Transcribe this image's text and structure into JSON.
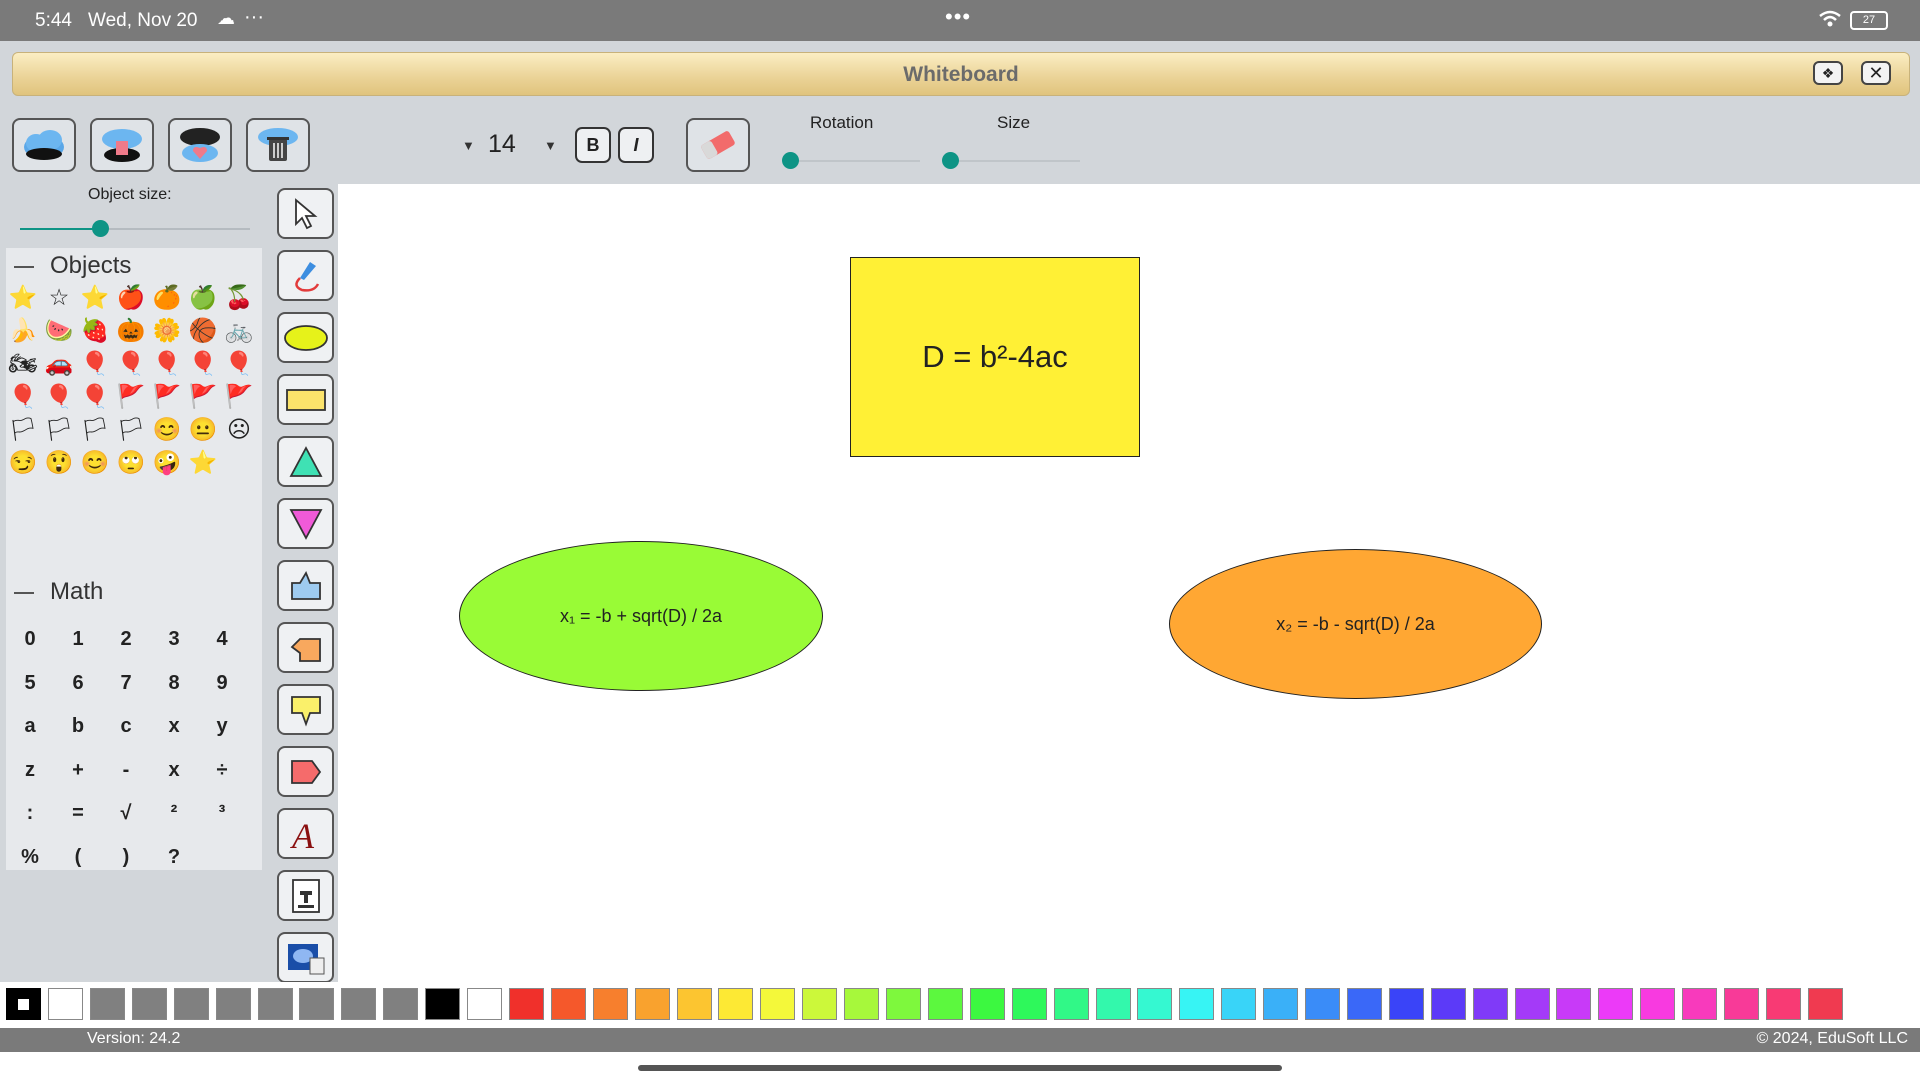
{
  "status_bar": {
    "time": "5:44",
    "date": "Wed, Nov 20",
    "overflow": "···",
    "center_handle": "•••",
    "battery": "27"
  },
  "window": {
    "title": "Whiteboard"
  },
  "toolbar": {
    "font_size": "14",
    "bold_label": "B",
    "italic_label": "I",
    "rotation_label": "Rotation",
    "size_label": "Size",
    "rotation_value": 0,
    "size_value": 0
  },
  "left_panel": {
    "object_size_label": "Object size:",
    "object_size_value": 0.35,
    "objects_title": "Objects",
    "objects": [
      "⭐",
      "☆",
      "⭐",
      "🍎",
      "🍊",
      "🍏",
      "🍒",
      "🍌",
      "🍉",
      "🍓",
      "🎃",
      "🌼",
      "🏀",
      "🚲",
      "🏍",
      "🚗",
      "🎈",
      "🎈",
      "🎈",
      "🎈",
      "🎈",
      "🎈",
      "🎈",
      "🎈",
      "🚩",
      "🚩",
      "🚩",
      "🚩",
      "🏳",
      "🏳",
      "🏳",
      "🏳",
      "😊",
      "😐",
      "☹",
      "😏",
      "😲",
      "😊",
      "🙄",
      "🤪",
      "⭐"
    ],
    "math_title": "Math",
    "math_keys": [
      "0",
      "1",
      "2",
      "3",
      "4",
      "5",
      "6",
      "7",
      "8",
      "9",
      "a",
      "b",
      "c",
      "x",
      "y",
      "z",
      "+",
      "-",
      "x",
      "÷",
      ":",
      "=",
      "√",
      "²",
      "³",
      "%",
      "(",
      ")",
      "?"
    ]
  },
  "tools": [
    "select-tool",
    "pen-tool",
    "ellipse-tool",
    "rectangle-tool",
    "triangle-up-tool",
    "triangle-down-tool",
    "callout-up-tool",
    "callout-left-tool",
    "callout-down-tool",
    "callout-right-tool",
    "text-tool",
    "stamp-tool",
    "image-tool"
  ],
  "canvas": {
    "rect_text": "D = b²-4ac",
    "rect_color": "#fff035",
    "ellipse1_text": "x₁ = -b + sqrt(D) / 2a",
    "ellipse1_color": "#99fb36",
    "ellipse2_text": "x₂ = -b - sqrt(D) / 2a",
    "ellipse2_color": "#ffa733"
  },
  "palette": [
    "#ffffff",
    "#808080",
    "#808080",
    "#808080",
    "#808080",
    "#808080",
    "#808080",
    "#808080",
    "#808080",
    "#000000",
    "#ffffff",
    "#f0302b",
    "#f5582b",
    "#f77f2d",
    "#f9a22e",
    "#fcc530",
    "#fde934",
    "#f4f83a",
    "#ccf83a",
    "#a7f83b",
    "#7ef83d",
    "#5cf83e",
    "#3cf840",
    "#2ef85b",
    "#31f887",
    "#33f8ac",
    "#35f8d1",
    "#37f4f4",
    "#39d4f8",
    "#3ab0f8",
    "#3a8cf8",
    "#3a68f8",
    "#3a44f8",
    "#5c3af8",
    "#803af8",
    "#a43af8",
    "#c83af8",
    "#ec3af8",
    "#f83ae0",
    "#f83abc",
    "#f83a98",
    "#f83a74",
    "#f03a50"
  ],
  "footer": {
    "version": "Version: 24.2",
    "copyright": "© 2024, EduSoft LLC"
  }
}
